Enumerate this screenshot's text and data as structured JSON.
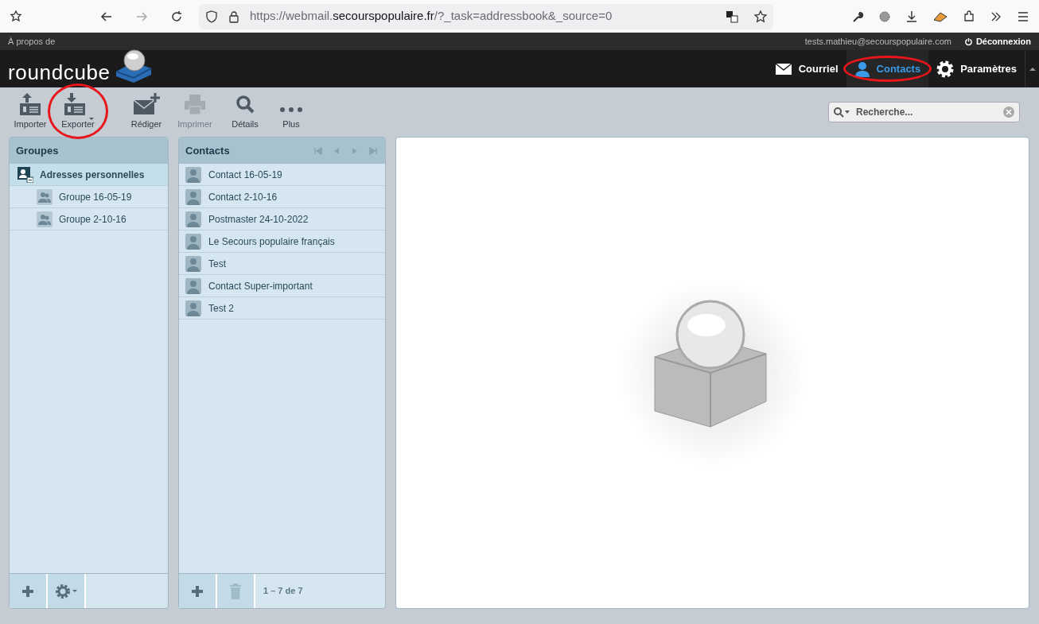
{
  "browser": {
    "url": "https://webmail.**secourspopulaire.fr**/?_task=addressbook&_source=0"
  },
  "topbar": {
    "about": "À propos de",
    "user": "tests.mathieu@secourspopulaire.com",
    "logout": "Déconnexion"
  },
  "logo": {
    "text": "roundcube"
  },
  "nav": [
    {
      "kind": "mail",
      "label": "Courriel",
      "selected": false,
      "annotated": false
    },
    {
      "kind": "contacts",
      "label": "Contacts",
      "selected": true,
      "annotated": true
    },
    {
      "kind": "settings",
      "label": "Paramètres",
      "selected": false,
      "annotated": false
    }
  ],
  "toolbar": [
    {
      "kind": "import",
      "label": "Importer",
      "disabled": false,
      "annotated": false
    },
    {
      "kind": "export",
      "label": "Exporter",
      "disabled": false,
      "annotated": true
    },
    {
      "kind": "compose",
      "label": "Rédiger",
      "disabled": false,
      "annotated": false
    },
    {
      "kind": "print",
      "label": "Imprimer",
      "disabled": true,
      "annotated": false
    },
    {
      "kind": "details",
      "label": "Détails",
      "disabled": false,
      "annotated": false
    },
    {
      "kind": "more",
      "label": "Plus",
      "disabled": false,
      "annotated": false
    }
  ],
  "search": {
    "placeholder": "Recherche..."
  },
  "groups": {
    "title": "Groupes",
    "items": [
      {
        "label": "Adresses personnelles",
        "selected": true,
        "children": [
          {
            "label": "Groupe 16-05-19",
            "selected": false
          },
          {
            "label": "Groupe 2-10-16",
            "selected": false
          }
        ]
      }
    ]
  },
  "contacts": {
    "title": "Contacts",
    "items": [
      {
        "label": "Contact 16-05-19",
        "selected": false
      },
      {
        "label": "Contact 2-10-16",
        "selected": false
      },
      {
        "label": "Postmaster 24-10-2022",
        "selected": false
      },
      {
        "label": "Le Secours populaire français",
        "selected": false
      },
      {
        "label": "Test",
        "selected": false
      },
      {
        "label": "Contact Super-important",
        "selected": false
      },
      {
        "label": "Test 2",
        "selected": false
      }
    ],
    "count": "1 – 7 de 7",
    "delete_disabled": true
  }
}
